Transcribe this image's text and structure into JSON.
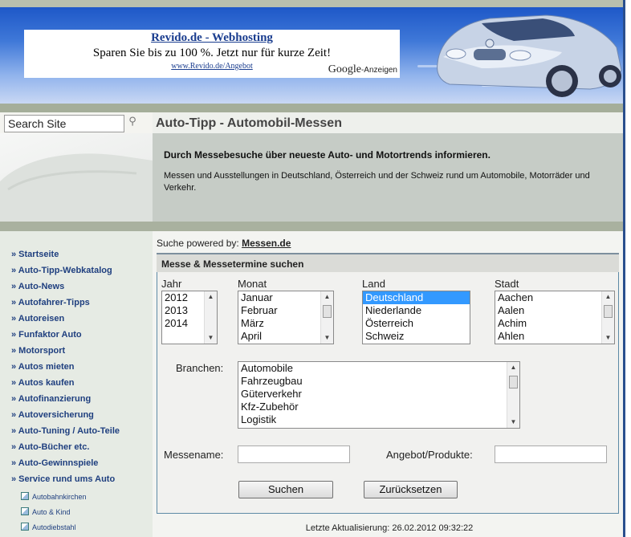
{
  "ad": {
    "title": "Revido.de - Webhosting",
    "text": "Sparen Sie bis zu 100 %. Jetzt nur für kurze Zeit!",
    "url": "www.Revido.de/Angebot",
    "google": "Google",
    "google_suffix": "-Anzeigen"
  },
  "search": {
    "placeholder": "Search Site",
    "value": "Search Site"
  },
  "page": {
    "title": "Auto-Tipp - Automobil-Messen",
    "intro_heading": "Durch Messebesuche über neueste Auto- und Motortrends informieren.",
    "intro_text": "Messen und Ausstellungen in Deutschland, Österreich und der Schweiz rund um Automobile, Motorräder und Verkehr."
  },
  "sidebar": {
    "items": [
      "» Startseite",
      "» Auto-Tipp-Webkatalog",
      "» Auto-News",
      "» Autofahrer-Tipps",
      "» Autoreisen",
      "» Funfaktor Auto",
      "» Motorsport",
      "» Autos mieten",
      "» Autos kaufen",
      "» Autofinanzierung",
      "» Autoversicherung",
      "» Auto-Tuning / Auto-Teile",
      "» Auto-Bücher etc.",
      "» Auto-Gewinnspiele",
      "» Service rund ums Auto"
    ],
    "sub_items": [
      "Autobahnkirchen",
      "Auto & Kind",
      "Autodiebstahl"
    ]
  },
  "form": {
    "powered_prefix": "Suche powered by:",
    "powered_link": "Messen.de",
    "header": "Messe & Messetermine suchen",
    "year_label": "Jahr",
    "years": [
      "2012",
      "2013",
      "2014"
    ],
    "month_label": "Monat",
    "months": [
      "Januar",
      "Februar",
      "März",
      "April"
    ],
    "country_label": "Land",
    "countries": [
      "Deutschland",
      "Niederlande",
      "Österreich",
      "Schweiz"
    ],
    "selected_country": "Deutschland",
    "city_label": "Stadt",
    "cities": [
      "Aachen",
      "Aalen",
      "Achim",
      "Ahlen"
    ],
    "branch_label": "Branchen:",
    "branches": [
      "Automobile",
      "Fahrzeugbau",
      "Güterverkehr",
      "Kfz-Zubehör",
      "Logistik"
    ],
    "fair_name_label": "Messename:",
    "offer_label": "Angebot/Produkte:",
    "search_button": "Suchen",
    "reset_button": "Zurücksetzen"
  },
  "footer": {
    "updated": "Letzte Aktualisierung: 26.02.2012 09:32:22"
  },
  "colors": {
    "nav_link": "#1f3f7f",
    "banner_blue": "#1e58c8",
    "selection": "#3399ff",
    "sidebar_bg": "#e6ebe4"
  }
}
